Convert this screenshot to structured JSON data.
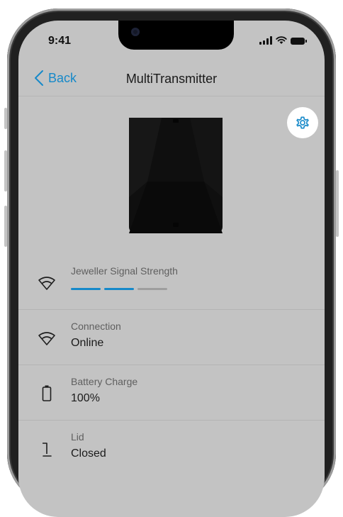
{
  "status_bar": {
    "time": "9:41"
  },
  "nav": {
    "back_label": "Back",
    "title": "MultiTransmitter"
  },
  "colors": {
    "accent": "#1689c9",
    "inactive_bar": "#9e9e9e",
    "screen_bg": "#c3c3c3"
  },
  "rows": [
    {
      "label": "Jeweller Signal Strength",
      "icon": "signal-strength-icon",
      "signal_level": 2,
      "signal_max": 3
    },
    {
      "label": "Connection",
      "value": "Online",
      "icon": "connection-icon"
    },
    {
      "label": "Battery Charge",
      "value": "100%",
      "icon": "battery-icon"
    },
    {
      "label": "Lid",
      "value": "Closed",
      "icon": "lid-icon"
    }
  ]
}
